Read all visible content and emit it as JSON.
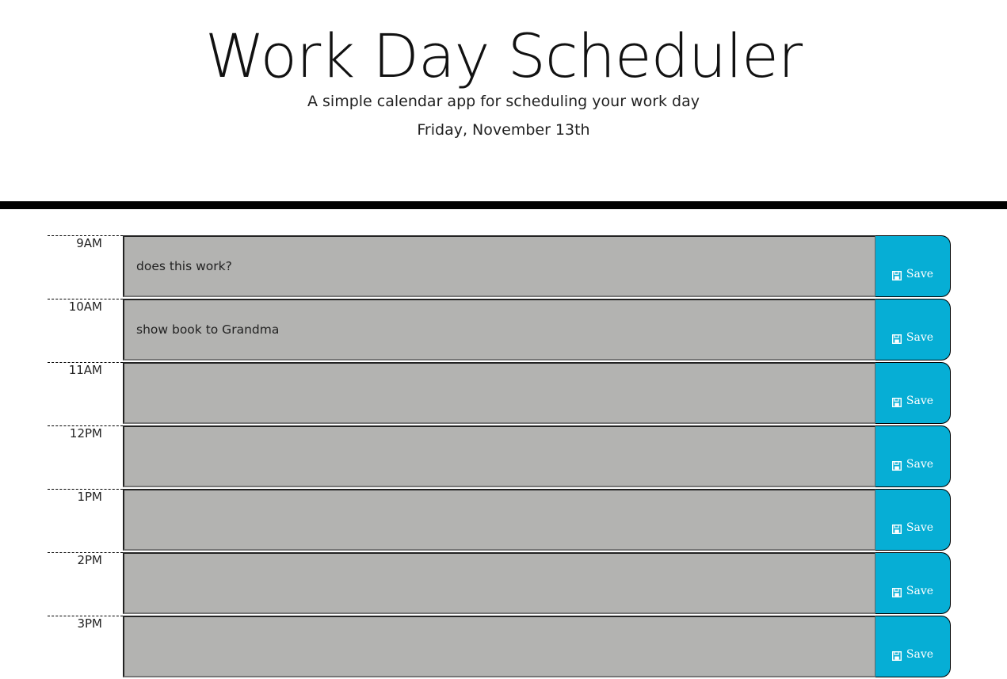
{
  "header": {
    "title": "Work Day Scheduler",
    "subtitle": "A simple calendar app for scheduling your work day",
    "current_day": "Friday, November 13th"
  },
  "colors": {
    "past": "#b3b3b1",
    "save": "#06aed5",
    "divider": "#000000"
  },
  "save_icon": "floppy-disk-icon",
  "time_blocks": [
    {
      "hour": "9AM",
      "text": "does this work?",
      "save_label": "Save"
    },
    {
      "hour": "10AM",
      "text": "show book to Grandma",
      "save_label": "Save"
    },
    {
      "hour": "11AM",
      "text": "",
      "save_label": "Save"
    },
    {
      "hour": "12PM",
      "text": "",
      "save_label": "Save"
    },
    {
      "hour": "1PM",
      "text": "",
      "save_label": "Save"
    },
    {
      "hour": "2PM",
      "text": "",
      "save_label": "Save"
    },
    {
      "hour": "3PM",
      "text": "",
      "save_label": "Save"
    }
  ]
}
